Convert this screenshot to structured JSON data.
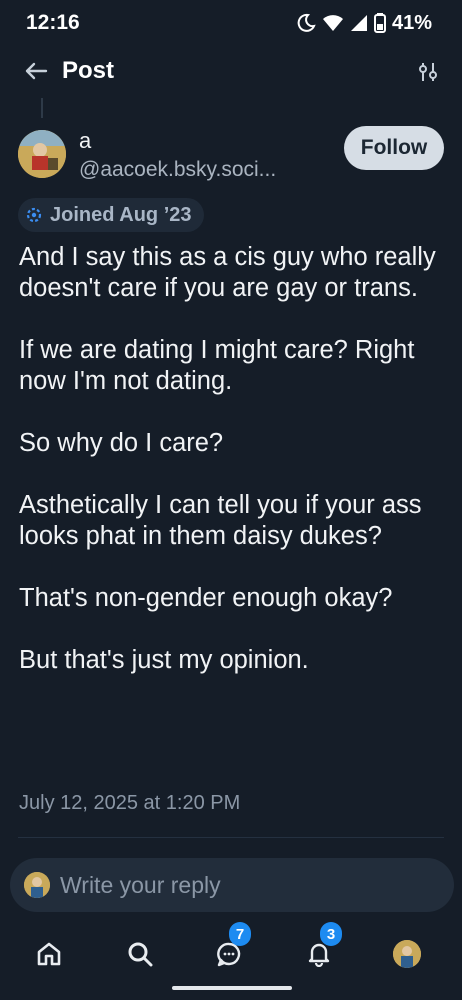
{
  "status_bar": {
    "time": "12:16",
    "battery": "41%"
  },
  "header": {
    "title": "Post",
    "back_icon": "arrow-left-icon",
    "filter_icon": "sliders-icon"
  },
  "author": {
    "name": "a",
    "handle": "@aacoek.bsky.soci...",
    "follow_label": "Follow"
  },
  "joined": {
    "label": "Joined Aug ’23",
    "icon": "bluesky-butterfly-icon"
  },
  "post": {
    "paragraphs": [
      "And I say this as a cis guy who really doesn't care if you are gay or trans.",
      "If we are dating I might care? Right now I'm not dating.",
      "So why do I care?",
      "Asthetically I can tell you if your ass looks phat in them daisy dukes?",
      "That's non-gender enough okay?",
      "But that's just my opinion."
    ],
    "date": "July 12, 2025 at 1:20 PM"
  },
  "reply": {
    "placeholder": "Write your reply"
  },
  "nav": {
    "items": [
      {
        "icon": "home-icon"
      },
      {
        "icon": "search-icon"
      },
      {
        "icon": "chat-icon",
        "badge": "7"
      },
      {
        "icon": "bell-icon",
        "badge": "3"
      },
      {
        "icon": "profile-avatar-icon"
      }
    ]
  },
  "colors": {
    "background": "#151d28",
    "accent": "#1d8bf1",
    "follow_button": "#d6dde5"
  }
}
